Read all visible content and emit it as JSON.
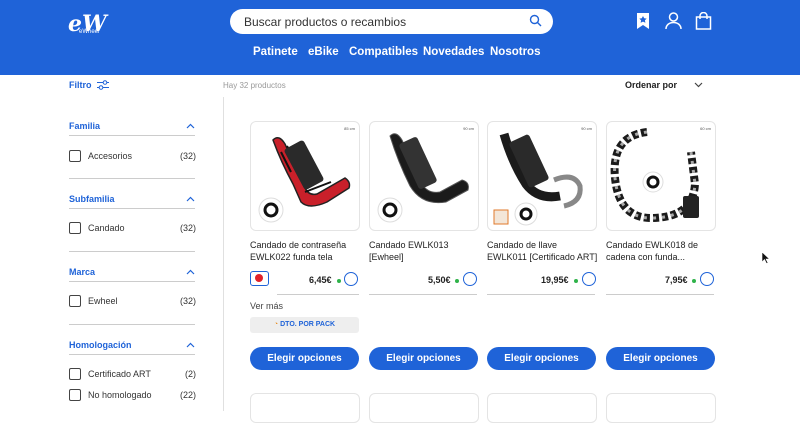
{
  "header": {
    "logo_text": "eW",
    "logo_sub": "eWheel",
    "search_placeholder": "Buscar productos o recambios",
    "nav": [
      "Patinete",
      "eBike",
      "Compatibles",
      "Novedades",
      "Nosotros"
    ],
    "brand_color": "#1f63d8"
  },
  "toolbar": {
    "filter_label": "Filtro",
    "count_text": "Hay 32 productos",
    "sort_label": "Ordenar por"
  },
  "sidebar": {
    "groups": [
      {
        "title": "Familia",
        "options": [
          {
            "label": "Accesorios",
            "count": "(32)"
          }
        ]
      },
      {
        "title": "Subfamilia",
        "options": [
          {
            "label": "Candado",
            "count": "(32)"
          }
        ]
      },
      {
        "title": "Marca",
        "options": [
          {
            "label": "Ewheel",
            "count": "(32)"
          }
        ]
      },
      {
        "title": "Homologación",
        "options": [
          {
            "label": "Certificado ART",
            "count": "(2)"
          },
          {
            "label": "No homologado",
            "count": "(22)"
          }
        ]
      }
    ]
  },
  "products": [
    {
      "title": "Candado de contraseña EWLK022 funda tela",
      "price": "6,45€",
      "button": "Elegir opciones",
      "badge": "85 cm"
    },
    {
      "title": "Candado EWLK013 [Ewheel]",
      "price": "5,50€",
      "button": "Elegir opciones",
      "badge": "90 cm"
    },
    {
      "title": "Candado de llave EWLK011 [Certificado ART]",
      "price": "19,95€",
      "button": "Elegir opciones",
      "badge": "90 cm"
    },
    {
      "title": "Candado EWLK018 de cadena con funda...",
      "price": "7,95€",
      "button": "Elegir opciones",
      "badge": "60 cm"
    }
  ],
  "product_extra": {
    "ver_mas": "Ver más",
    "pack_label": "DTO. POR PACK"
  },
  "colors": {
    "stock_dot": "#2fb34a",
    "swatch": "#e0222a"
  }
}
